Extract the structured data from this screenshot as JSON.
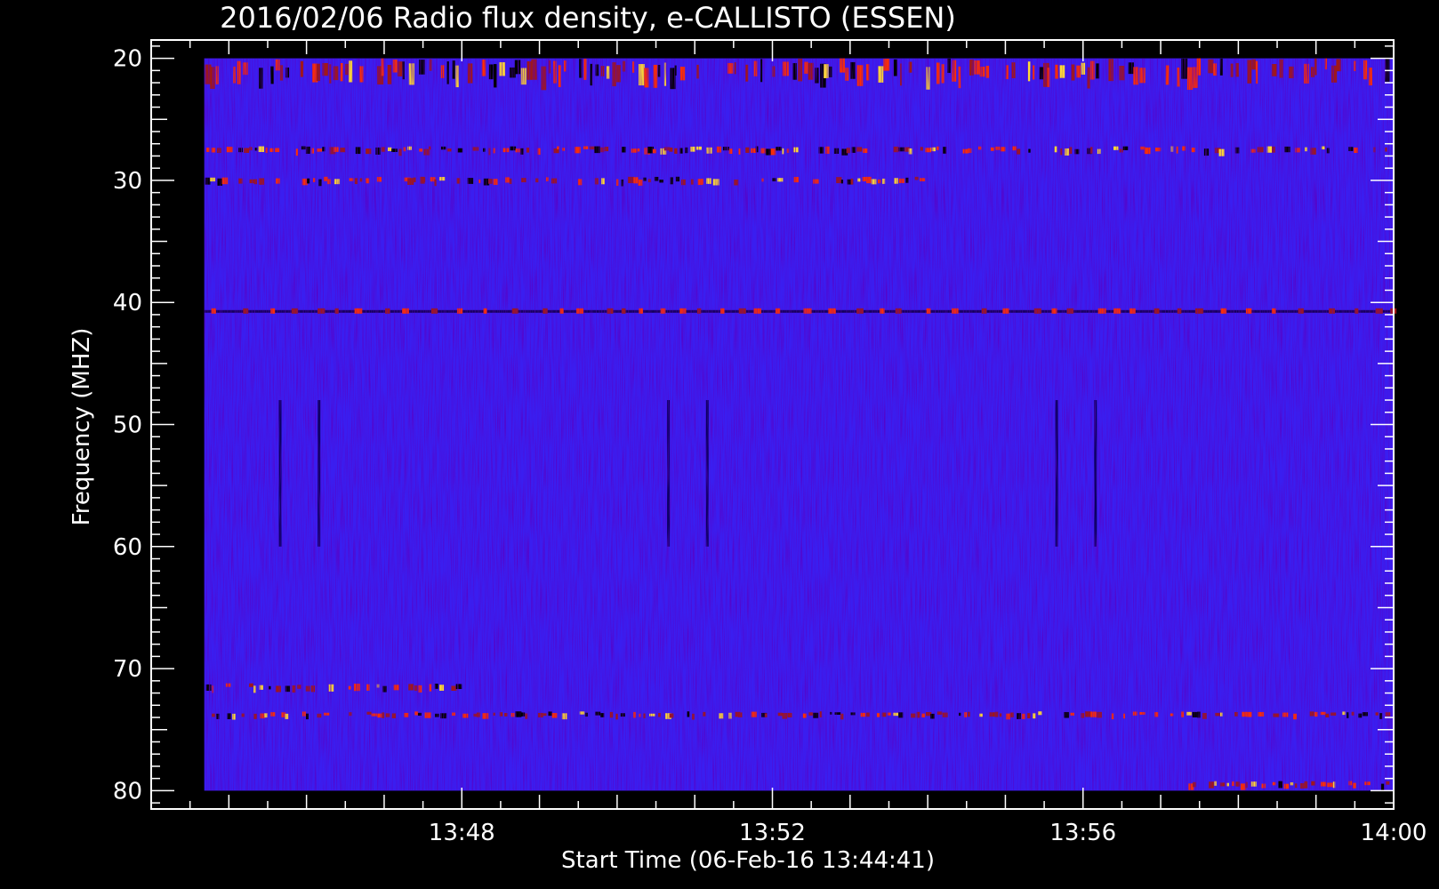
{
  "chart_data": {
    "type": "heatmap",
    "title": "2016/02/06  Radio flux density, e-CALLISTO (ESSEN)",
    "xlabel": "Start Time (06-Feb-16 13:44:41)",
    "ylabel": "Frequency (MHZ)",
    "x_unit": "UT time",
    "x_range": [
      "13:44:41",
      "14:00:00"
    ],
    "x_axis_range": [
      "13:44:00",
      "14:00:00"
    ],
    "x_ticks": [
      "13:48",
      "13:52",
      "13:56",
      "14:00"
    ],
    "y_range_mhz": [
      20,
      80
    ],
    "y_axis_range_mhz": [
      18.5,
      81.5
    ],
    "y_ticks": [
      20,
      30,
      40,
      50,
      60,
      70,
      80
    ],
    "y_inverted": true,
    "colormap": [
      "#000000",
      "#1a00c8",
      "#3a1ef0",
      "#a01818",
      "#ff3000",
      "#ffdd33"
    ],
    "background_level_color": "#3a1ef0",
    "features": [
      {
        "name": "intermittent emission band",
        "freq_mhz": [
          20,
          22
        ],
        "time": [
          "13:44:41",
          "14:00:00"
        ]
      },
      {
        "name": "dotted interference line",
        "freq_mhz": 41,
        "time": [
          "13:44:41",
          "14:00:00"
        ]
      },
      {
        "name": "emission band",
        "freq_mhz": 27.5,
        "time": [
          "13:44:41",
          "14:00:00"
        ]
      },
      {
        "name": "emission band",
        "freq_mhz": 30,
        "time": [
          "13:44:41",
          "13:54:00"
        ]
      },
      {
        "name": "emission band",
        "freq_mhz": 71.5,
        "time": [
          "13:44:41",
          "13:48:00"
        ]
      },
      {
        "name": "interference band",
        "freq_mhz": [
          73.5,
          74
        ],
        "time": [
          "13:44:41",
          "14:00:00"
        ]
      },
      {
        "name": "emission band",
        "freq_mhz": 79.5,
        "time": [
          "13:57:20",
          "14:00:00"
        ]
      },
      {
        "name": "vertical dropout",
        "time": "13:45:40",
        "freq_mhz": [
          48,
          60
        ]
      },
      {
        "name": "vertical dropout",
        "time": "13:46:10",
        "freq_mhz": [
          48,
          60
        ]
      },
      {
        "name": "vertical dropout",
        "time": "13:50:40",
        "freq_mhz": [
          48,
          60
        ]
      },
      {
        "name": "vertical dropout",
        "time": "13:51:10",
        "freq_mhz": [
          48,
          60
        ]
      },
      {
        "name": "vertical dropout",
        "time": "13:55:40",
        "freq_mhz": [
          48,
          60
        ]
      },
      {
        "name": "vertical dropout",
        "time": "13:56:10",
        "freq_mhz": [
          48,
          60
        ]
      }
    ]
  }
}
